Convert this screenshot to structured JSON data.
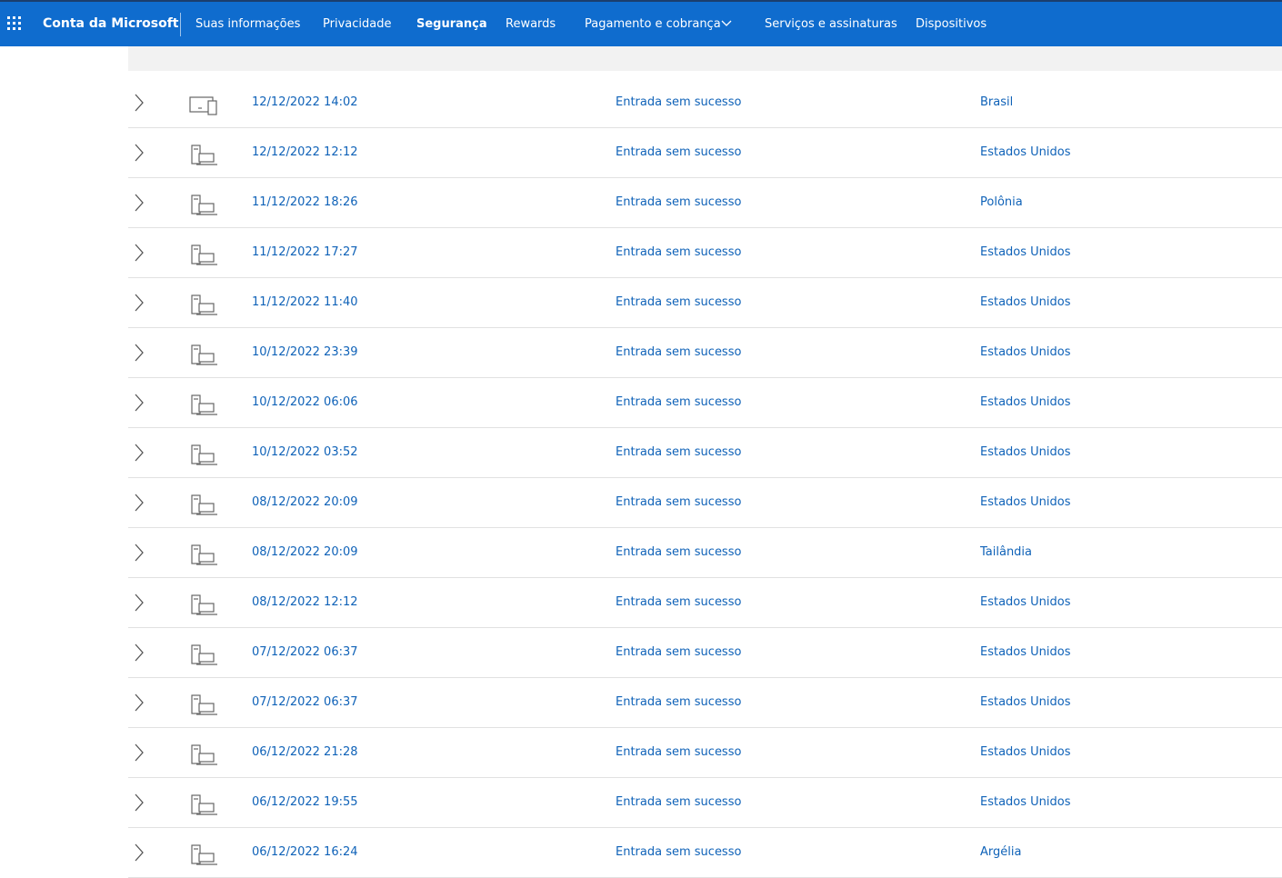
{
  "header": {
    "brand": "Conta da Microsoft",
    "nav": [
      {
        "label": "Suas informações",
        "active": false
      },
      {
        "label": "Privacidade",
        "active": false
      },
      {
        "label": "Segurança",
        "active": true
      },
      {
        "label": "Rewards",
        "active": false
      },
      {
        "label": "Pagamento e cobrança",
        "active": false,
        "dropdown": true
      },
      {
        "label": "Serviços e assinaturas",
        "active": false
      },
      {
        "label": "Dispositivos",
        "active": false
      }
    ],
    "icons": {
      "app_launcher": "waffle-icon",
      "dropdown": "chevron-down-icon"
    }
  },
  "activity": {
    "rows": [
      {
        "date": "12/12/2022 14:02",
        "status": "Entrada sem sucesso",
        "location": "Brasil",
        "device": "multi-device-icon"
      },
      {
        "date": "12/12/2022 12:12",
        "status": "Entrada sem sucesso",
        "location": "Estados Unidos",
        "device": "desktop-laptop-icon"
      },
      {
        "date": "11/12/2022 18:26",
        "status": "Entrada sem sucesso",
        "location": "Polônia",
        "device": "desktop-laptop-icon"
      },
      {
        "date": "11/12/2022 17:27",
        "status": "Entrada sem sucesso",
        "location": "Estados Unidos",
        "device": "desktop-laptop-icon"
      },
      {
        "date": "11/12/2022 11:40",
        "status": "Entrada sem sucesso",
        "location": "Estados Unidos",
        "device": "desktop-laptop-icon"
      },
      {
        "date": "10/12/2022 23:39",
        "status": "Entrada sem sucesso",
        "location": "Estados Unidos",
        "device": "desktop-laptop-icon"
      },
      {
        "date": "10/12/2022 06:06",
        "status": "Entrada sem sucesso",
        "location": "Estados Unidos",
        "device": "desktop-laptop-icon"
      },
      {
        "date": "10/12/2022 03:52",
        "status": "Entrada sem sucesso",
        "location": "Estados Unidos",
        "device": "desktop-laptop-icon"
      },
      {
        "date": "08/12/2022 20:09",
        "status": "Entrada sem sucesso",
        "location": "Estados Unidos",
        "device": "desktop-laptop-icon"
      },
      {
        "date": "08/12/2022 20:09",
        "status": "Entrada sem sucesso",
        "location": "Tailândia",
        "device": "desktop-laptop-icon"
      },
      {
        "date": "08/12/2022 12:12",
        "status": "Entrada sem sucesso",
        "location": "Estados Unidos",
        "device": "desktop-laptop-icon"
      },
      {
        "date": "07/12/2022 06:37",
        "status": "Entrada sem sucesso",
        "location": "Estados Unidos",
        "device": "desktop-laptop-icon"
      },
      {
        "date": "07/12/2022 06:37",
        "status": "Entrada sem sucesso",
        "location": "Estados Unidos",
        "device": "desktop-laptop-icon"
      },
      {
        "date": "06/12/2022 21:28",
        "status": "Entrada sem sucesso",
        "location": "Estados Unidos",
        "device": "desktop-laptop-icon"
      },
      {
        "date": "06/12/2022 19:55",
        "status": "Entrada sem sucesso",
        "location": "Estados Unidos",
        "device": "desktop-laptop-icon"
      },
      {
        "date": "06/12/2022 16:24",
        "status": "Entrada sem sucesso",
        "location": "Argélia",
        "device": "desktop-laptop-icon"
      }
    ]
  },
  "colors": {
    "topbar": "#0f6cce",
    "link": "#0f62b8",
    "divider": "#e1e1e1",
    "strip": "#f2f2f2"
  }
}
